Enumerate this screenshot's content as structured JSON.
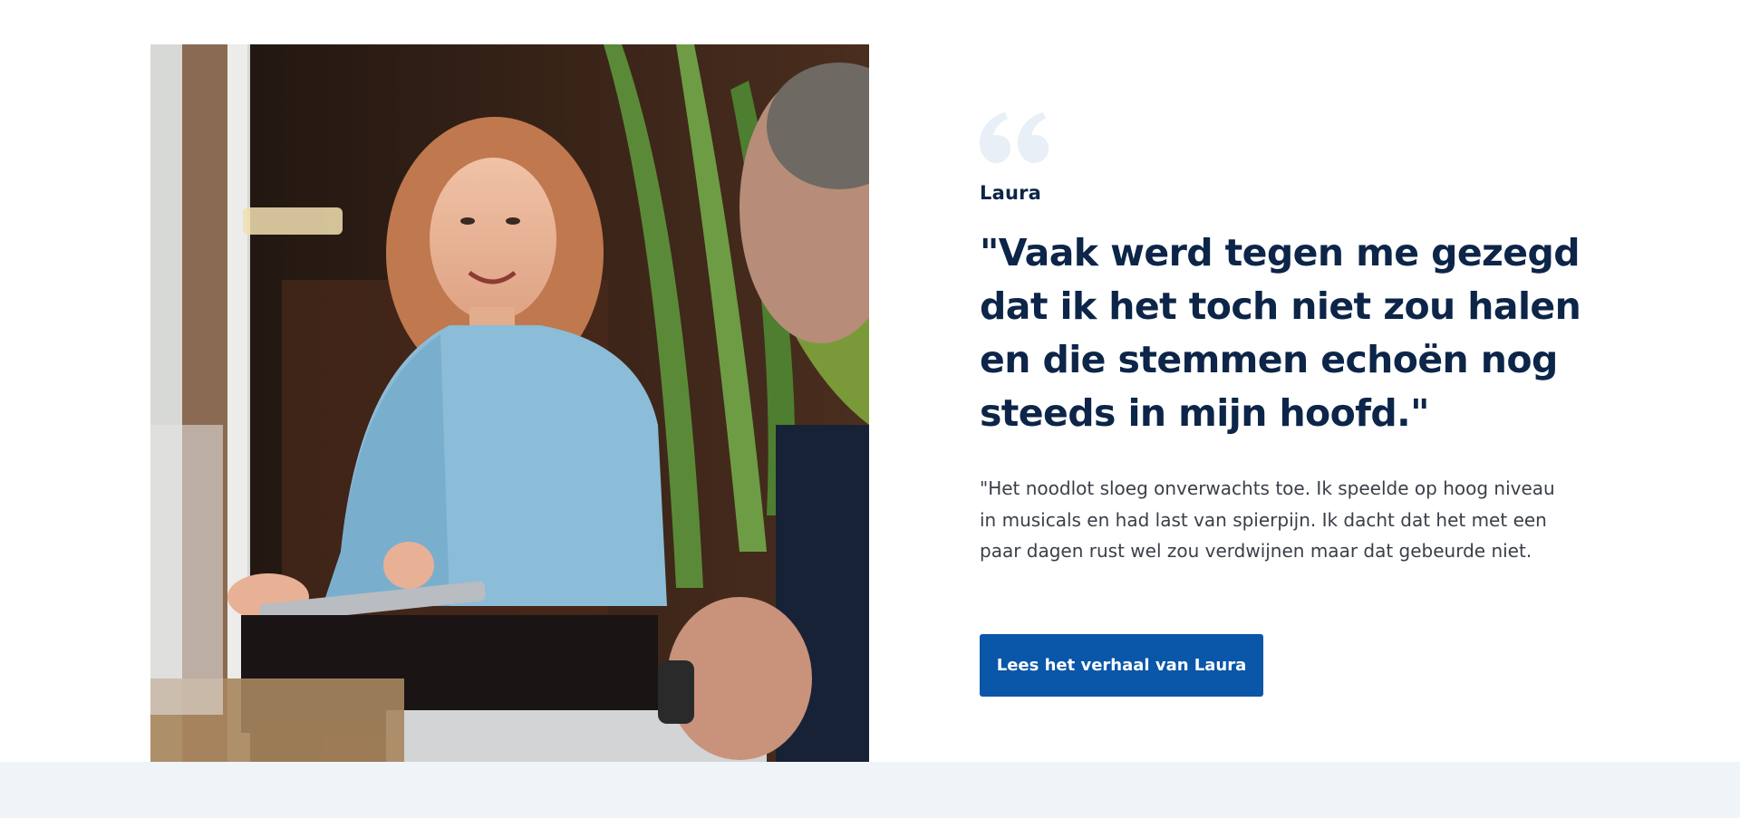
{
  "testimonial": {
    "author": "Laura",
    "headline": "\"Vaak werd tegen me gezegd dat ik het toch niet zou halen en die stemmen echoën nog steeds in mijn hoofd.\"",
    "body": "\"Het noodlot sloeg onverwachts toe. Ik speelde op hoog niveau in musicals en had last van spierpijn. Ik dacht dat het met een paar dagen rust wel zou verdwijnen maar dat gebeurde niet.",
    "cta_label": "Lees het verhaal van Laura"
  },
  "colors": {
    "heading": "#0c2548",
    "body_text": "#3a3f48",
    "button_bg": "#0a56a8",
    "quote_mark": "#e8eff6",
    "footer_band": "#eff4f8"
  },
  "icons": {
    "quote": "quote-open-icon"
  }
}
